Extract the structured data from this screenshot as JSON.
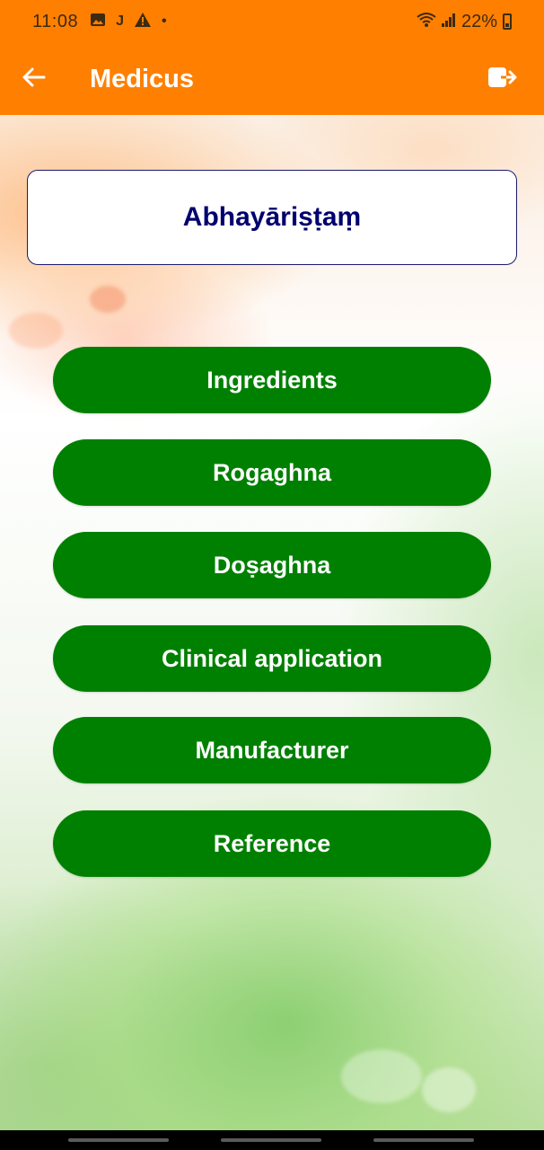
{
  "status_bar": {
    "time": "11:08",
    "notification_icons": [
      "image-icon",
      "j-icon",
      "warning-icon",
      "dot-icon"
    ],
    "battery_text": "22%"
  },
  "app_bar": {
    "title": "Medicus",
    "back_icon": "arrow-left-icon",
    "logout_icon": "logout-icon"
  },
  "main": {
    "medicine_name": "Abhayāriṣṭaṃ",
    "menu_items": [
      {
        "label": "Ingredients"
      },
      {
        "label": "Rogaghna"
      },
      {
        "label": "Doṣaghna"
      },
      {
        "label": "Clinical application"
      },
      {
        "label": "Manufacturer"
      },
      {
        "label": "Reference"
      }
    ]
  },
  "colors": {
    "app_bar": "#ff8000",
    "button": "#008000",
    "title_text": "#00006e"
  }
}
